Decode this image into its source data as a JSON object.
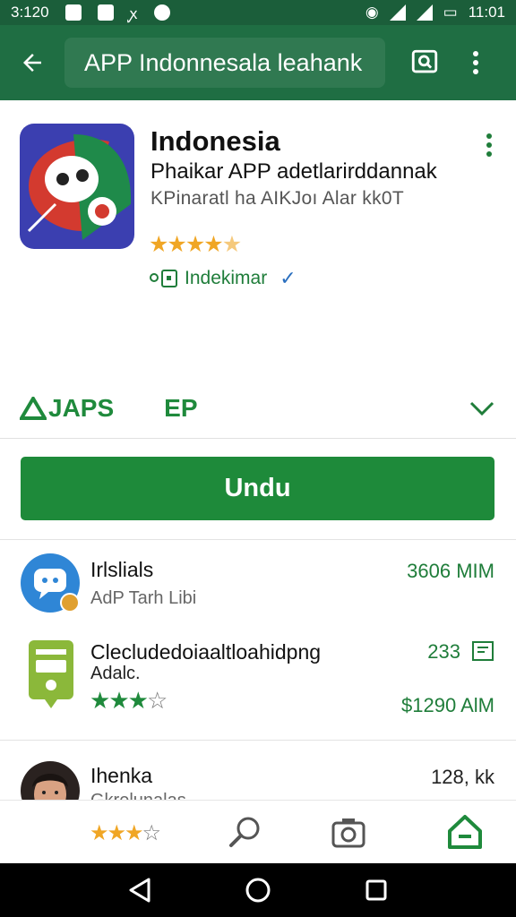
{
  "status_bar": {
    "time": "3:120",
    "clock": "11:01"
  },
  "search": {
    "query": "APP Indonnesala leahank"
  },
  "app": {
    "name": "Indonesia",
    "developer": "Phaikar APP adetlarirddannak",
    "category": "KPinaratl ha AIKJoı Alar kk0T",
    "rating": 4,
    "badge": "Indekimar",
    "verify_mark": "✓"
  },
  "meta": {
    "apps_label": "JAPS",
    "ep_label": "EP"
  },
  "install": {
    "label": "Undu"
  },
  "list": [
    {
      "title": "Irlslials",
      "subtitle": "AdP Tarh Libi",
      "meta": "3606 MIM"
    },
    {
      "title": "Clecludedoiaaltloahidpng",
      "subtitle": "Adalc.",
      "meta": "233",
      "meta2": "$1290 AlM",
      "rating": 3
    },
    {
      "title": "Ihenka",
      "subtitle": "Gkrelunalas",
      "meta": "128, kk"
    }
  ],
  "bottom_bar": {
    "rating": 3
  },
  "colors": {
    "accent": "#1e8a3a",
    "app_bar": "#1f6e43",
    "star": "#f0a625"
  }
}
